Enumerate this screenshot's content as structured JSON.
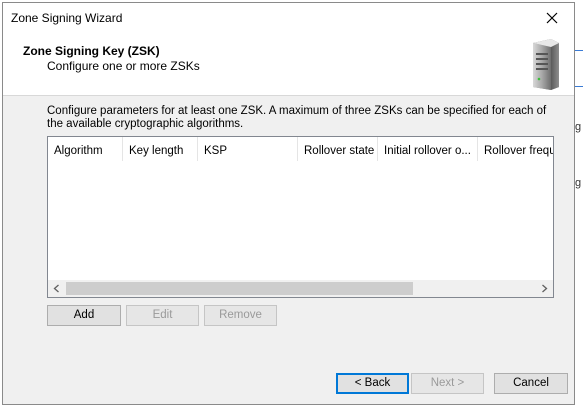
{
  "window": {
    "title": "Zone Signing Wizard"
  },
  "header": {
    "title": "Zone Signing Key (ZSK)",
    "subtitle": "Configure one or more ZSKs"
  },
  "instructions": "Configure parameters for at least one ZSK. A maximum of three ZSKs can be specified for each of the available cryptographic algorithms.",
  "list": {
    "columns": [
      "Algorithm",
      "Key length",
      "KSP",
      "Rollover state",
      "Initial rollover o...",
      "Rollover frequ"
    ]
  },
  "list_buttons": {
    "add": "Add",
    "edit": "Edit",
    "remove": "Remove"
  },
  "footer": {
    "back": "< Back",
    "next": "Next >",
    "cancel": "Cancel"
  },
  "background": {
    "glyph_top": "g",
    "glyph_mid": "g"
  },
  "colors": {
    "focus_border": "#0078d7",
    "disabled_text": "#9a9a9a"
  },
  "icons": [
    "close-icon",
    "server-icon",
    "scroll-left-icon",
    "scroll-right-icon"
  ]
}
